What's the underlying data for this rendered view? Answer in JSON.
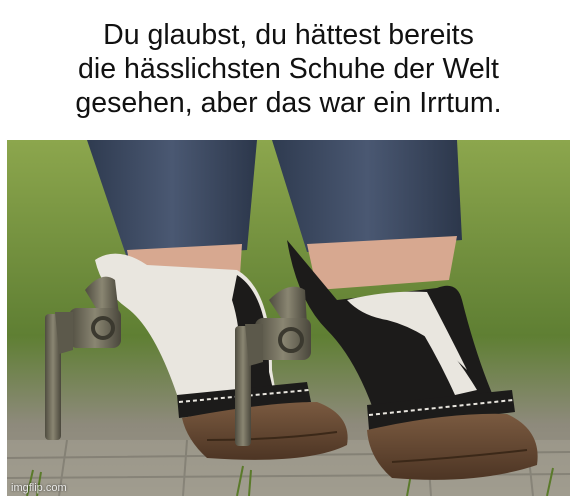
{
  "caption": {
    "lines": [
      "Du glaubst, du hättest bereits",
      "die hässlichsten Schuhe der Welt",
      "gesehen, aber das war ein Irrtum."
    ]
  },
  "photo": {
    "subject": "cowhide high-heel shoes with revolver heels and hoof toes",
    "watermark": "imgflip.com"
  },
  "colors": {
    "background": "#ffffff",
    "text": "#111111",
    "grass": "#6f8f3c",
    "jeans": "#3d4a60",
    "hide_white": "#e9e6df",
    "hide_black": "#1c1b1a",
    "hoof": "#6b4a32",
    "gun_metal": "#6d6a5c"
  }
}
